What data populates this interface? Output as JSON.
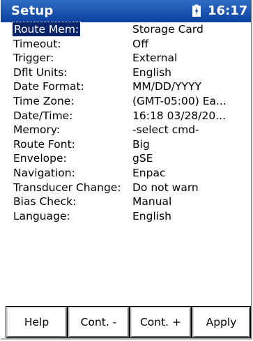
{
  "window": {
    "title": "Setup",
    "clock": "16:17",
    "battery_icon": "battery-icon"
  },
  "settings": [
    {
      "label": "Route Mem:",
      "value": "Storage Card",
      "selected": true
    },
    {
      "label": "Timeout:",
      "value": "Off"
    },
    {
      "label": "Trigger:",
      "value": "External"
    },
    {
      "label": "Dflt Units:",
      "value": "English"
    },
    {
      "label": "Date Format:",
      "value": "MM/DD/YYYY"
    },
    {
      "label": "Time Zone:",
      "value": "(GMT-05:00) Ea..."
    },
    {
      "label": "Date/Time:",
      "value": "16:18 03/28/20..."
    },
    {
      "label": "Memory:",
      "value": "-select cmd-"
    },
    {
      "label": "Route Font:",
      "value": "Big"
    },
    {
      "label": "Envelope:",
      "value": "gSE"
    },
    {
      "label": "Navigation:",
      "value": "Enpac"
    },
    {
      "label": "Transducer Change:",
      "value": "Do not warn"
    },
    {
      "label": "Bias Check:",
      "value": "Manual"
    },
    {
      "label": "Language:",
      "value": "English"
    }
  ],
  "buttons": {
    "help": "Help",
    "cont_minus": "Cont. -",
    "cont_plus": "Cont. +",
    "apply": "Apply"
  },
  "colors": {
    "titlebar": "#0a3f9e",
    "selection": "#0a246a"
  }
}
